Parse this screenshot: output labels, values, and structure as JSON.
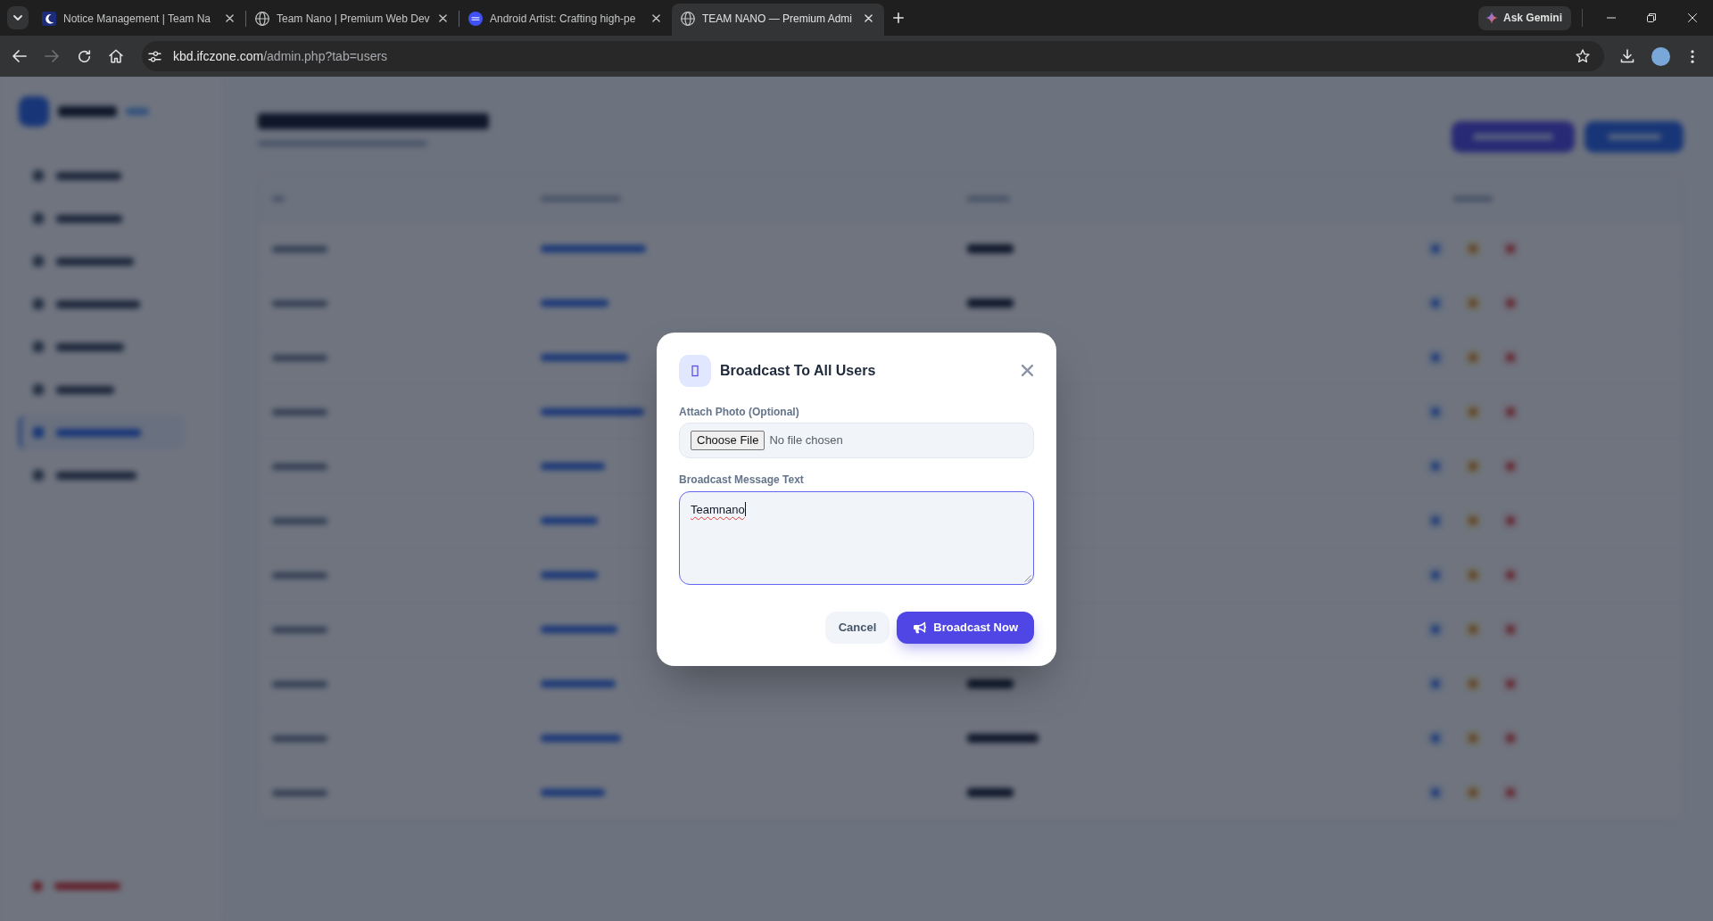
{
  "browser": {
    "tabs": [
      {
        "title": "Notice Management | Team Na",
        "selected": false
      },
      {
        "title": "Team Nano | Premium Web Dev",
        "selected": false
      },
      {
        "title": "Android Artist: Crafting high-pe",
        "selected": false
      },
      {
        "title": "TEAM NANO — Premium Admi",
        "selected": true
      }
    ],
    "ask_gemini": "Ask Gemini",
    "address": {
      "host": "kbd.ifczone.com",
      "path": "/admin.php?tab=users"
    },
    "forward_disabled": true
  },
  "modal": {
    "title": "Broadcast To All Users",
    "photo_field": {
      "label": "Attach Photo (Optional)",
      "button": "Choose File",
      "status": "No file chosen"
    },
    "message_field": {
      "label": "Broadcast Message Text",
      "value": "Teamnano",
      "focused": true,
      "misspelled": true
    },
    "buttons": [
      {
        "label": "Cancel",
        "kind": "secondary"
      },
      {
        "label": "Broadcast Now",
        "kind": "primary"
      }
    ]
  }
}
